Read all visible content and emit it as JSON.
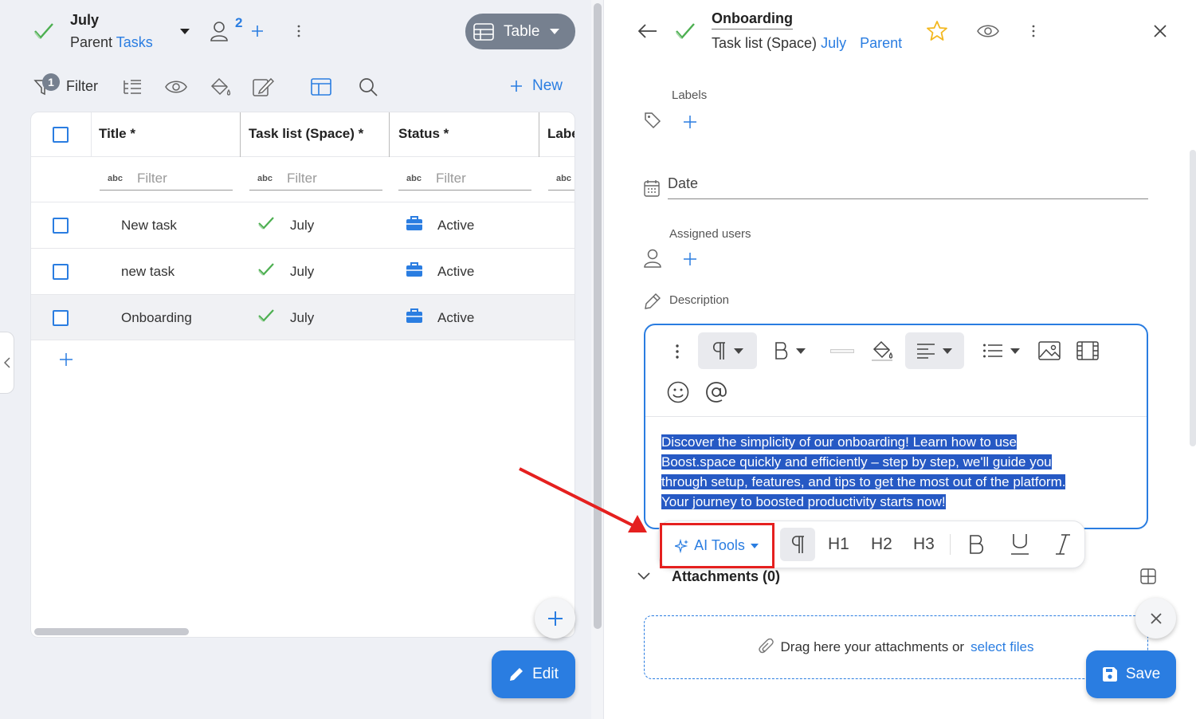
{
  "header": {
    "title": "July",
    "parent_prefix": "Parent",
    "parent_link": "Tasks",
    "assigned_count": "2",
    "view_label": "Table"
  },
  "toolbar": {
    "filter_badge": "1",
    "filter_label": "Filter",
    "new_label": "New"
  },
  "table": {
    "columns": [
      "Title *",
      "Task list (Space) *",
      "Status *",
      "Labe"
    ],
    "filter_placeholder": "Filter",
    "filter_abc": "abc",
    "rows": [
      {
        "title": "New task",
        "task_list": "July",
        "status": "Active"
      },
      {
        "title": "new task",
        "task_list": "July",
        "status": "Active"
      },
      {
        "title": "Onboarding",
        "task_list": "July",
        "status": "Active"
      }
    ]
  },
  "edit_label": "Edit",
  "detail": {
    "title": "Onboarding",
    "subtitle_prefix": "Task list (Space)",
    "subtitle_link1": "July",
    "subtitle_link2": "Parent",
    "labels_label": "Labels",
    "date_label": "Date",
    "assigned_label": "Assigned users",
    "description_label": "Description",
    "description_text": "Discover the simplicity of our onboarding! Learn how to use Boost.space quickly and efficiently – step by step, we'll guide you through setup, features, and tips to get the most out of the platform. Your journey to boosted productivity starts now!",
    "description_lines": [
      "Discover the simplicity of our onboarding! Learn how to use ",
      "Boost.space quickly and efficiently – step by step, we'll guide you ",
      "through setup, features, and tips to get the most out of the platform. ",
      "Your journey to boosted productivity starts now!"
    ],
    "ai_tools_label": "AI Tools",
    "format_buttons": [
      "H1",
      "H2",
      "H3"
    ],
    "attachments_label": "Attachments (0)",
    "drop_text": "Drag here your attachments or",
    "drop_link": "select files",
    "save_label": "Save"
  },
  "colors": {
    "accent": "#2a7de1",
    "check_green": "#4caf50",
    "highlight": "#2659c4",
    "arrow_red": "#e5201f",
    "star": "#f3b820"
  }
}
